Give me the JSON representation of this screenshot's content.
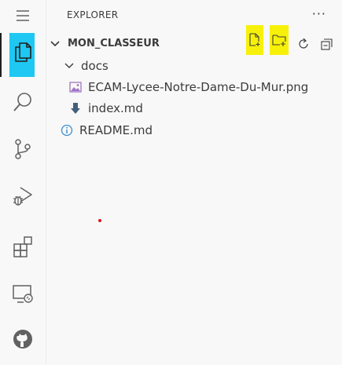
{
  "activity_bar": {
    "items": [
      {
        "icon": "menu-icon"
      },
      {
        "icon": "explorer-files-icon",
        "active": true,
        "highlight_color": "#1ec8f2"
      },
      {
        "icon": "search-icon"
      },
      {
        "icon": "source-control-icon"
      },
      {
        "icon": "run-debug-icon"
      },
      {
        "icon": "extensions-icon"
      },
      {
        "icon": "remote-explorer-icon"
      },
      {
        "icon": "github-icon"
      }
    ]
  },
  "sidebar": {
    "title": "EXPLORER",
    "more_actions": "···",
    "folder": {
      "name": "MON_CLASSEUR",
      "actions": [
        {
          "icon": "new-file-icon",
          "highlight_color": "#f7f10a"
        },
        {
          "icon": "new-folder-icon",
          "highlight_color": "#f7f10a"
        },
        {
          "icon": "refresh-icon"
        },
        {
          "icon": "collapse-all-icon"
        }
      ]
    },
    "tree": [
      {
        "label": "docs",
        "type": "folder",
        "expanded": true
      },
      {
        "label": "ECAM-Lycee-Notre-Dame-Du-Mur.png",
        "type": "image",
        "icon_color": "#a074c4"
      },
      {
        "label": "index.md",
        "type": "markdown",
        "icon_color": "#42607a"
      },
      {
        "label": "README.md",
        "type": "info",
        "icon_color": "#3d8fd1"
      }
    ]
  },
  "colors": {
    "background": "#f8f8f8",
    "text": "#3b3b3b",
    "explorer_highlight": "#1ec8f2",
    "action_highlight": "#f7f10a",
    "cursor_dot": "#e0141e"
  }
}
